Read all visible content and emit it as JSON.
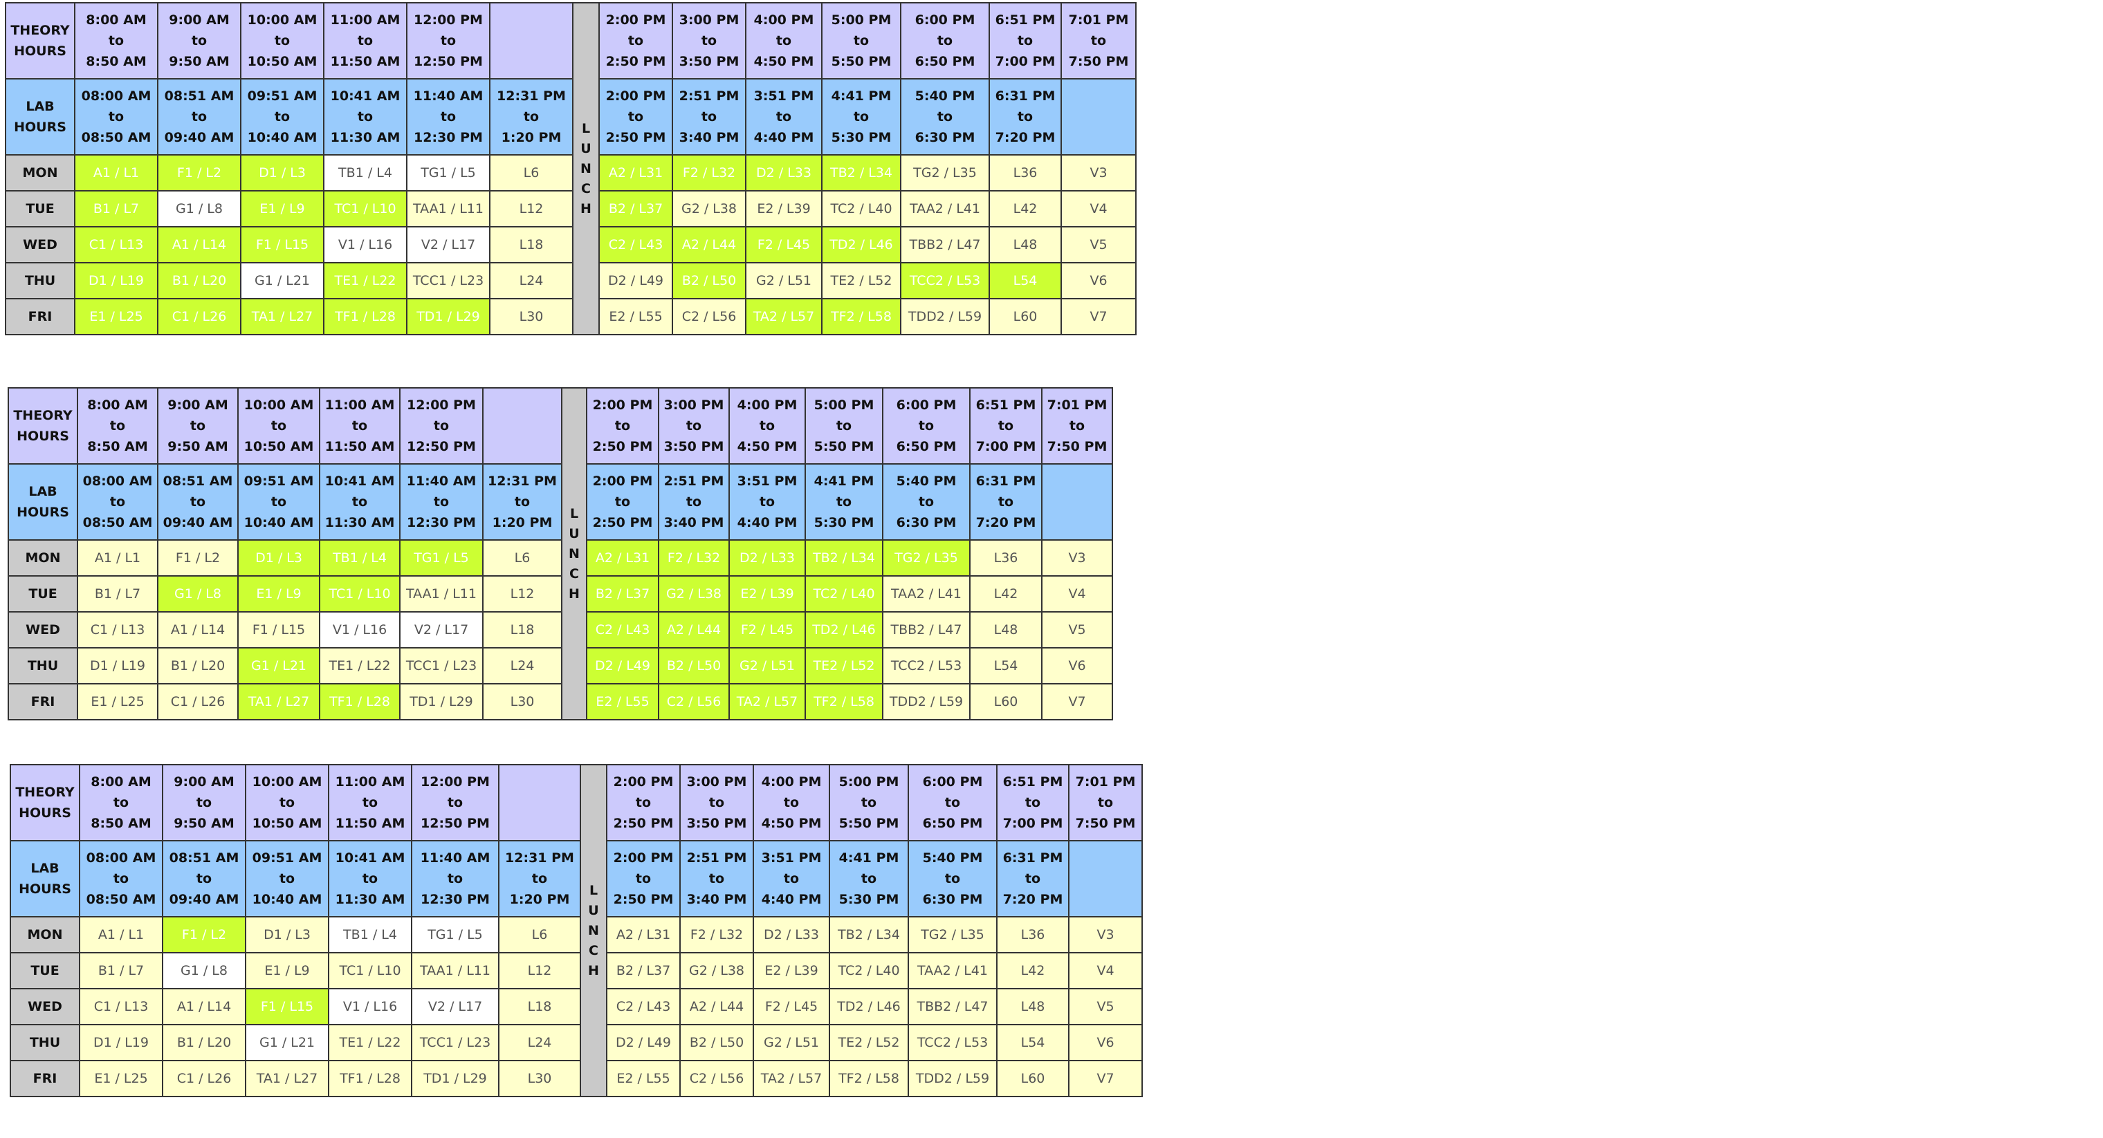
{
  "labels": {
    "theory_hours": "THEORY HOURS",
    "lab_hours": "LAB HOURS",
    "lunch_letters": [
      "L",
      "U",
      "N",
      "C",
      "H"
    ],
    "days": [
      "MON",
      "TUE",
      "WED",
      "THU",
      "FRI"
    ]
  },
  "colors": {
    "theory_header": "#cccafc",
    "lab_header": "#99cbfc",
    "row_label": "#cbcbcb",
    "lunch": "#c9c9c9",
    "theory_slot": "#ffffcc",
    "lab_slot": "#ffffff",
    "selected": "#ccff33"
  },
  "theory_times": [
    [
      "8:00 AM",
      "to",
      "8:50 AM"
    ],
    [
      "9:00 AM",
      "to",
      "9:50 AM"
    ],
    [
      "10:00 AM",
      "to",
      "10:50 AM"
    ],
    [
      "11:00 AM",
      "to",
      "11:50 AM"
    ],
    [
      "12:00 PM",
      "to",
      "12:50 PM"
    ],
    [
      "",
      "",
      ""
    ],
    [
      "2:00 PM",
      "to",
      "2:50 PM"
    ],
    [
      "3:00 PM",
      "to",
      "3:50 PM"
    ],
    [
      "4:00 PM",
      "to",
      "4:50 PM"
    ],
    [
      "5:00 PM",
      "to",
      "5:50 PM"
    ],
    [
      "6:00 PM",
      "to",
      "6:50 PM"
    ],
    [
      "6:51 PM",
      "to",
      "7:00 PM"
    ],
    [
      "7:01 PM",
      "to",
      "7:50 PM"
    ]
  ],
  "lab_times": [
    [
      "08:00 AM",
      "to",
      "08:50 AM"
    ],
    [
      "08:51 AM",
      "to",
      "09:40 AM"
    ],
    [
      "09:51 AM",
      "to",
      "10:40 AM"
    ],
    [
      "10:41 AM",
      "to",
      "11:30 AM"
    ],
    [
      "11:40 AM",
      "to",
      "12:30 PM"
    ],
    [
      "12:31 PM",
      "to",
      "1:20 PM"
    ],
    [
      "2:00 PM",
      "to",
      "2:50 PM"
    ],
    [
      "2:51 PM",
      "to",
      "3:40 PM"
    ],
    [
      "3:51 PM",
      "to",
      "4:40 PM"
    ],
    [
      "4:41 PM",
      "to",
      "5:30 PM"
    ],
    [
      "5:40 PM",
      "to",
      "6:30 PM"
    ],
    [
      "6:31 PM",
      "to",
      "7:20 PM"
    ],
    [
      "",
      "",
      ""
    ]
  ],
  "slots": [
    [
      "A1 / L1",
      "F1 / L2",
      "D1 / L3",
      "TB1 / L4",
      "TG1 / L5",
      "L6",
      "A2 / L31",
      "F2 / L32",
      "D2 / L33",
      "TB2 / L34",
      "TG2 / L35",
      "L36",
      "V3"
    ],
    [
      "B1 / L7",
      "G1 / L8",
      "E1 / L9",
      "TC1 / L10",
      "TAA1 / L11",
      "L12",
      "B2 / L37",
      "G2 / L38",
      "E2 / L39",
      "TC2 / L40",
      "TAA2 / L41",
      "L42",
      "V4"
    ],
    [
      "C1 / L13",
      "A1 / L14",
      "F1 / L15",
      "V1 / L16",
      "V2 / L17",
      "L18",
      "C2 / L43",
      "A2 / L44",
      "F2 / L45",
      "TD2 / L46",
      "TBB2 / L47",
      "L48",
      "V5"
    ],
    [
      "D1 / L19",
      "B1 / L20",
      "G1 / L21",
      "TE1 / L22",
      "TCC1 / L23",
      "L24",
      "D2 / L49",
      "B2 / L50",
      "G2 / L51",
      "TE2 / L52",
      "TCC2 / L53",
      "L54",
      "V6"
    ],
    [
      "E1 / L25",
      "C1 / L26",
      "TA1 / L27",
      "TF1 / L28",
      "TD1 / L29",
      "L30",
      "E2 / L55",
      "C2 / L56",
      "TA2 / L57",
      "TF2 / L58",
      "TDD2 / L59",
      "L60",
      "V7"
    ]
  ],
  "base_types": [
    [
      "y",
      "y",
      "y",
      "w",
      "w",
      "y",
      "y",
      "y",
      "y",
      "y",
      "y",
      "y",
      "y"
    ],
    [
      "y",
      "w",
      "y",
      "y",
      "y",
      "y",
      "y",
      "y",
      "y",
      "y",
      "y",
      "y",
      "y"
    ],
    [
      "y",
      "y",
      "y",
      "w",
      "w",
      "y",
      "y",
      "y",
      "y",
      "y",
      "y",
      "y",
      "y"
    ],
    [
      "y",
      "y",
      "w",
      "y",
      "y",
      "y",
      "y",
      "y",
      "y",
      "y",
      "y",
      "y",
      "y"
    ],
    [
      "y",
      "y",
      "y",
      "y",
      "y",
      "y",
      "y",
      "y",
      "y",
      "y",
      "y",
      "y",
      "y"
    ]
  ],
  "timetables": [
    {
      "name": "timetable-1",
      "selected": [
        [
          1,
          1,
          1,
          0,
          0,
          0,
          1,
          1,
          1,
          1,
          0,
          0,
          0
        ],
        [
          1,
          0,
          1,
          1,
          0,
          0,
          1,
          0,
          0,
          0,
          0,
          0,
          0
        ],
        [
          1,
          1,
          1,
          0,
          0,
          0,
          1,
          1,
          1,
          1,
          0,
          0,
          0
        ],
        [
          1,
          1,
          0,
          1,
          0,
          0,
          0,
          1,
          0,
          0,
          1,
          1,
          0
        ],
        [
          1,
          1,
          1,
          1,
          1,
          0,
          0,
          0,
          1,
          1,
          0,
          0,
          0
        ]
      ]
    },
    {
      "name": "timetable-2",
      "selected": [
        [
          0,
          0,
          1,
          1,
          1,
          0,
          1,
          1,
          1,
          1,
          1,
          0,
          0
        ],
        [
          0,
          1,
          1,
          1,
          0,
          0,
          1,
          1,
          1,
          1,
          0,
          0,
          0
        ],
        [
          0,
          0,
          0,
          0,
          0,
          0,
          1,
          1,
          1,
          1,
          0,
          0,
          0
        ],
        [
          0,
          0,
          1,
          0,
          0,
          0,
          1,
          1,
          1,
          1,
          0,
          0,
          0
        ],
        [
          0,
          0,
          1,
          1,
          0,
          0,
          1,
          1,
          1,
          1,
          0,
          0,
          0
        ]
      ]
    },
    {
      "name": "timetable-3",
      "selected": [
        [
          0,
          1,
          0,
          0,
          0,
          0,
          0,
          0,
          0,
          0,
          0,
          0,
          0
        ],
        [
          0,
          0,
          0,
          0,
          0,
          0,
          0,
          0,
          0,
          0,
          0,
          0,
          0
        ],
        [
          0,
          0,
          1,
          0,
          0,
          0,
          0,
          0,
          0,
          0,
          0,
          0,
          0
        ],
        [
          0,
          0,
          0,
          0,
          0,
          0,
          0,
          0,
          0,
          0,
          0,
          0,
          0
        ],
        [
          0,
          0,
          0,
          0,
          0,
          0,
          0,
          0,
          0,
          0,
          0,
          0,
          0
        ]
      ]
    }
  ]
}
